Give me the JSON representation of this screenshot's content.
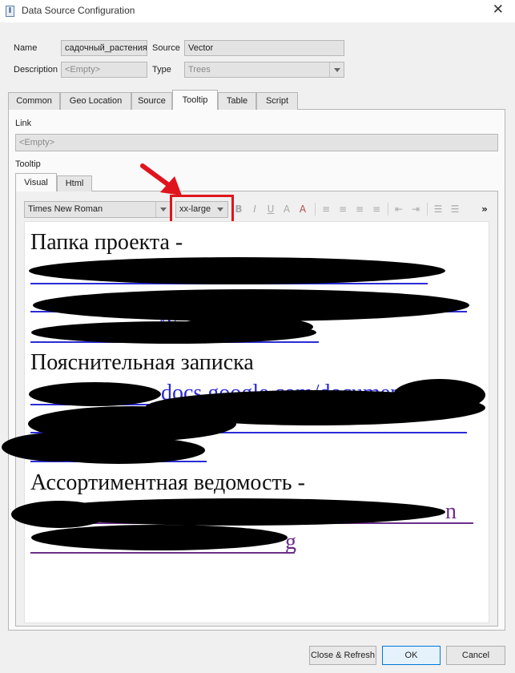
{
  "window": {
    "title": "Data Source Configuration",
    "close_glyph": "✕",
    "app_icon_glyph": "I"
  },
  "form": {
    "name_label": "Name",
    "name_value": "садочный_растения",
    "source_label": "Source",
    "source_value": "Vector",
    "description_label": "Description",
    "description_value": "<Empty>",
    "type_label": "Type",
    "type_value": "Trees"
  },
  "tabs": [
    {
      "label": "Common",
      "active": false
    },
    {
      "label": "Geo Location",
      "active": false
    },
    {
      "label": "Source",
      "active": false
    },
    {
      "label": "Tooltip",
      "active": true
    },
    {
      "label": "Table",
      "active": false
    },
    {
      "label": "Script",
      "active": false
    }
  ],
  "tooltip_tab": {
    "link_label": "Link",
    "link_value": "<Empty>",
    "tooltip_label": "Tooltip",
    "sub_tabs": [
      {
        "label": "Visual",
        "active": true
      },
      {
        "label": "Html",
        "active": false
      }
    ],
    "toolbar": {
      "font_family": "Times New Roman",
      "font_size": "xx-large",
      "bold": "B",
      "italic": "I",
      "underline": "U",
      "strike": "A",
      "clear_format": "A",
      "more": "»"
    },
    "editor": {
      "heading1": "Папка проекта -",
      "heading2": "Пояснительная записка",
      "heading3": "Ассортиментная ведомость -",
      "link_fragment_1": "/T",
      "link_fragment_2": "docs.google.com/documen",
      "link_fragment_3": "n",
      "link_fragment_4": "g"
    }
  },
  "buttons": {
    "close_refresh": "Close & Refresh",
    "ok": "OK",
    "cancel": "Cancel"
  },
  "colors": {
    "highlight": "#e0141c",
    "arrow": "#e0141c",
    "link": "#2b2bd8",
    "visited_link": "#6b2f8a"
  }
}
